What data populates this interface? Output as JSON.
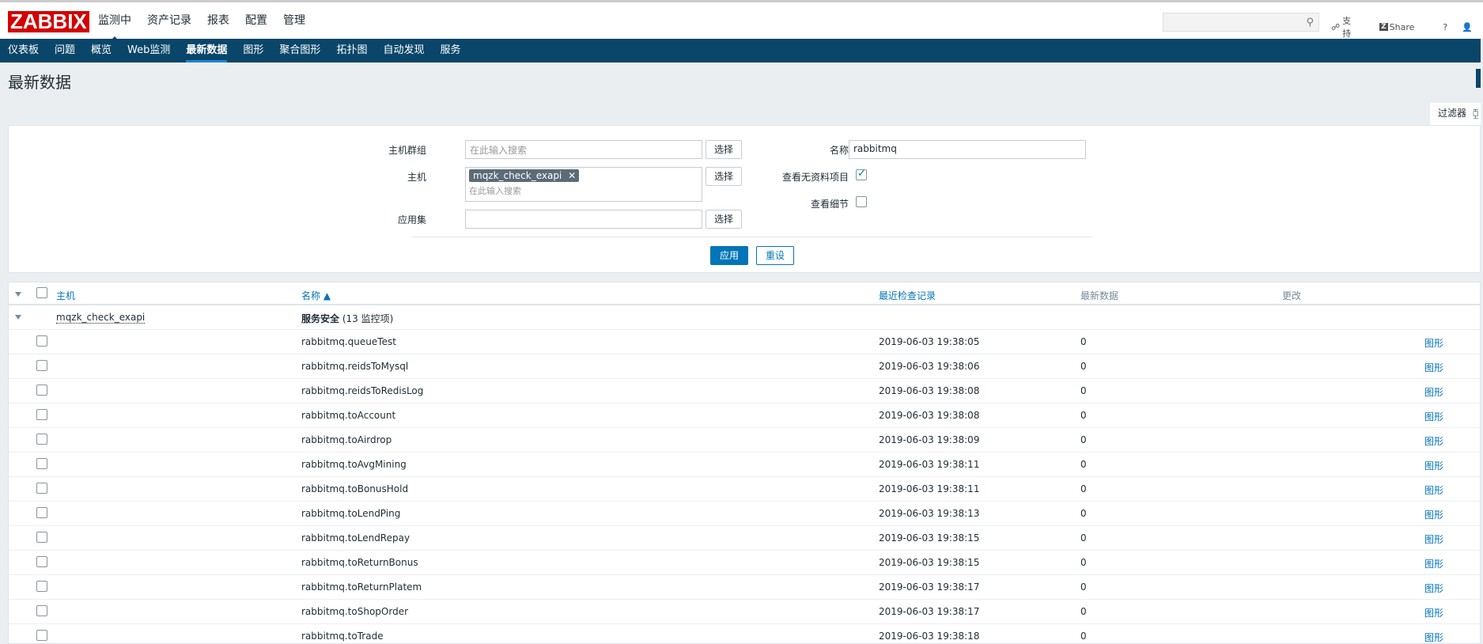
{
  "logo": "ZABBIX",
  "main_menu": [
    "监测中",
    "资产记录",
    "报表",
    "配置",
    "管理"
  ],
  "top_links": {
    "support": "支持",
    "share": "Share",
    "help": "?",
    "user": "👤"
  },
  "sub_menu": [
    "仪表板",
    "问题",
    "概览",
    "Web监测",
    "最新数据",
    "图形",
    "聚合图形",
    "拓扑图",
    "自动发现",
    "服务"
  ],
  "page_title": "最新数据",
  "filter_tab": "过滤器",
  "filter": {
    "host_groups_label": "主机群组",
    "host_groups_placeholder": "在此输入搜索",
    "hosts_label": "主机",
    "host_chip": "mqzk_check_exapi",
    "hosts_placeholder": "在此输入搜索",
    "app_label": "应用集",
    "select_label": "选择",
    "name_label": "名称",
    "name_value": "rabbitmq",
    "show_no_data_label": "查看无资料项目",
    "show_no_data_checked": true,
    "show_details_label": "查看细节",
    "show_details_checked": false,
    "apply": "应用",
    "reset": "重设"
  },
  "table": {
    "headers": {
      "host": "主机",
      "name": "名称 ▲",
      "last_check": "最近检查记录",
      "last_value": "最新数据",
      "change": "更改"
    },
    "group_host": "mqzk_check_exapi",
    "group_app": "服务安全",
    "group_count": "(13 监控项)",
    "graph_label": "图形",
    "rows": [
      {
        "name": "rabbitmq.queueTest",
        "time": "2019-06-03 19:38:05",
        "value": "0"
      },
      {
        "name": "rabbitmq.reidsToMysql",
        "time": "2019-06-03 19:38:06",
        "value": "0"
      },
      {
        "name": "rabbitmq.reidsToRedisLog",
        "time": "2019-06-03 19:38:08",
        "value": "0"
      },
      {
        "name": "rabbitmq.toAccount",
        "time": "2019-06-03 19:38:08",
        "value": "0"
      },
      {
        "name": "rabbitmq.toAirdrop",
        "time": "2019-06-03 19:38:09",
        "value": "0"
      },
      {
        "name": "rabbitmq.toAvgMining",
        "time": "2019-06-03 19:38:11",
        "value": "0"
      },
      {
        "name": "rabbitmq.toBonusHold",
        "time": "2019-06-03 19:38:11",
        "value": "0"
      },
      {
        "name": "rabbitmq.toLendPing",
        "time": "2019-06-03 19:38:13",
        "value": "0"
      },
      {
        "name": "rabbitmq.toLendRepay",
        "time": "2019-06-03 19:38:15",
        "value": "0"
      },
      {
        "name": "rabbitmq.toReturnBonus",
        "time": "2019-06-03 19:38:15",
        "value": "0"
      },
      {
        "name": "rabbitmq.toReturnPlatem",
        "time": "2019-06-03 19:38:17",
        "value": "0"
      },
      {
        "name": "rabbitmq.toShopOrder",
        "time": "2019-06-03 19:38:17",
        "value": "0"
      },
      {
        "name": "rabbitmq.toTrade",
        "time": "2019-06-03 19:38:18",
        "value": "0"
      }
    ]
  }
}
